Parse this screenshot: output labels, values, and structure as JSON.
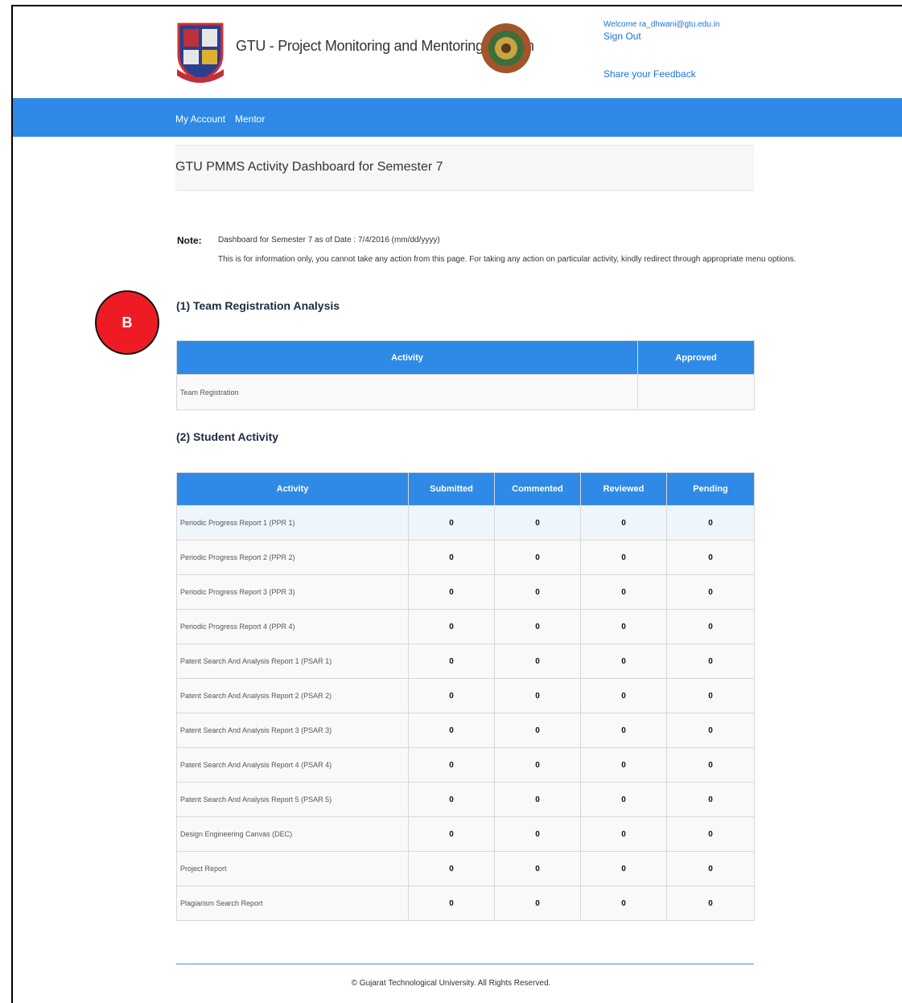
{
  "header": {
    "title": "GTU - Project Monitoring and Mentoring System",
    "welcome_text": "Welcome ra_dhwani@gtu.edu.in",
    "sign_out": "Sign Out",
    "feedback": "Share your Feedback"
  },
  "nav": {
    "items": [
      {
        "label": "My Account"
      },
      {
        "label": "Mentor"
      }
    ],
    "color": "#2e8ae6"
  },
  "dashboard": {
    "title": "GTU PMMS Activity Dashboard for Semester 7"
  },
  "note": {
    "label": "Note:",
    "line1": "Dashboard for Semester 7 as of Date : 7/4/2016 (mm/dd/yyyy)",
    "line2": "This is for information only, you cannot take any action from this page. For taking any action on particular activity, kindly redirect through appropriate menu options."
  },
  "badge": {
    "label": "B",
    "color": "#ee1b24"
  },
  "team_registration": {
    "heading": "(1) Team Registration Analysis",
    "columns": [
      "Activity",
      "Approved"
    ],
    "rows": [
      {
        "activity": "Team Registration",
        "approved": ""
      }
    ]
  },
  "student_activity": {
    "heading": "(2) Student Activity",
    "columns": [
      "Activity",
      "Submitted",
      "Commented",
      "Reviewed",
      "Pending"
    ],
    "rows": [
      {
        "activity": "Periodic Progress Report 1 (PPR 1)",
        "submitted": "0",
        "commented": "0",
        "reviewed": "0",
        "pending": "0"
      },
      {
        "activity": "Periodic Progress Report 2 (PPR 2)",
        "submitted": "0",
        "commented": "0",
        "reviewed": "0",
        "pending": "0"
      },
      {
        "activity": "Periodic Progress Report 3 (PPR 3)",
        "submitted": "0",
        "commented": "0",
        "reviewed": "0",
        "pending": "0"
      },
      {
        "activity": "Periodic Progress Report 4 (PPR 4)",
        "submitted": "0",
        "commented": "0",
        "reviewed": "0",
        "pending": "0"
      },
      {
        "activity": "Patent Search And Analysis Report 1 (PSAR 1)",
        "submitted": "0",
        "commented": "0",
        "reviewed": "0",
        "pending": "0"
      },
      {
        "activity": "Patent Search And Analysis Report 2 (PSAR 2)",
        "submitted": "0",
        "commented": "0",
        "reviewed": "0",
        "pending": "0"
      },
      {
        "activity": "Patent Search And Analysis Report 3 (PSAR 3)",
        "submitted": "0",
        "commented": "0",
        "reviewed": "0",
        "pending": "0"
      },
      {
        "activity": "Patent Search And Analysis Report 4 (PSAR 4)",
        "submitted": "0",
        "commented": "0",
        "reviewed": "0",
        "pending": "0"
      },
      {
        "activity": "Patent Search And Analysis Report 5 (PSAR 5)",
        "submitted": "0",
        "commented": "0",
        "reviewed": "0",
        "pending": "0"
      },
      {
        "activity": "Design Engineering Canvas (DEC)",
        "submitted": "0",
        "commented": "0",
        "reviewed": "0",
        "pending": "0"
      },
      {
        "activity": "Project Report",
        "submitted": "0",
        "commented": "0",
        "reviewed": "0",
        "pending": "0"
      },
      {
        "activity": "Plagiarism Search Report",
        "submitted": "0",
        "commented": "0",
        "reviewed": "0",
        "pending": "0"
      }
    ]
  },
  "footer": {
    "text": "© Gujarat Technological University. All Rights Reserved."
  }
}
